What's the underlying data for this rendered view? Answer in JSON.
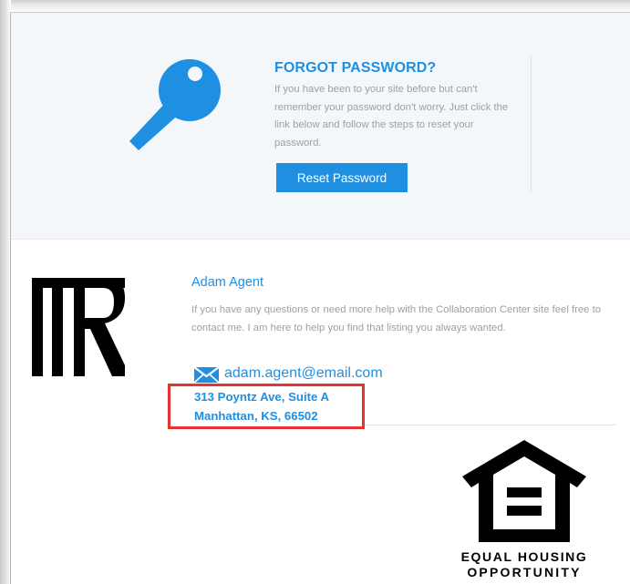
{
  "colors": {
    "accent": "#1e8fe1",
    "muted_text": "#9aa1a8",
    "highlight": "#e63434",
    "panel_bg": "#f4f7fa"
  },
  "forgot_password": {
    "icon": "key-icon",
    "title": "FORGOT PASSWORD?",
    "body": "If you have been to your site before but can't remember your password don't worry. Just click the link below and follow the steps to reset your password.",
    "button_label": "Reset Password"
  },
  "agent": {
    "logo": "realtor-logo",
    "name": "Adam Agent",
    "message": "If you have any questions or need more help with the Collaboration Center site feel free to contact me. I am here to help you find that listing you always wanted.",
    "email_icon": "envelope-icon",
    "email": "adam.agent@email.com",
    "address_line1": "313 Poyntz Ave, Suite A",
    "address_line2": "Manhattan, KS, 66502"
  },
  "equal_housing": {
    "icon": "equal-housing-house-icon",
    "line1": "EQUAL HOUSING",
    "line2": "OPPORTUNITY"
  }
}
